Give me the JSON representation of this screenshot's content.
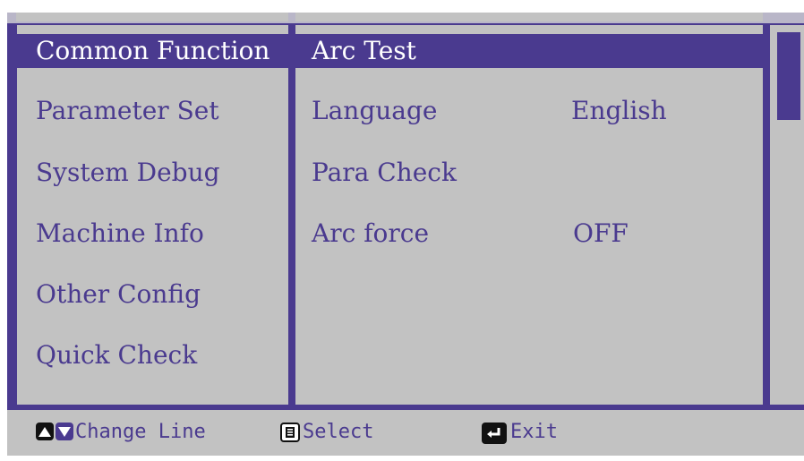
{
  "menu": {
    "items": [
      {
        "label": "Common Function",
        "selected": true
      },
      {
        "label": "Parameter Set",
        "selected": false
      },
      {
        "label": "System Debug",
        "selected": false
      },
      {
        "label": "Machine Info",
        "selected": false
      },
      {
        "label": "Other Config",
        "selected": false
      },
      {
        "label": "Quick Check",
        "selected": false
      }
    ]
  },
  "submenu": {
    "items": [
      {
        "label": "Arc Test",
        "value": "",
        "selected": true
      },
      {
        "label": "Language",
        "value": "English",
        "selected": false
      },
      {
        "label": "Para Check",
        "value": "",
        "selected": false
      },
      {
        "label": "Arc force",
        "value": "OFF",
        "selected": false
      }
    ]
  },
  "footer": {
    "change_line": "Change Line",
    "select": "Select",
    "exit": "Exit",
    "icons": [
      "up-arrow-key-icon",
      "down-arrow-key-icon",
      "menu-key-icon",
      "enter-key-icon"
    ]
  },
  "colors": {
    "accent": "#4a3a8f",
    "panel": "#c2c2c2",
    "text_selected": "#ffffff"
  }
}
